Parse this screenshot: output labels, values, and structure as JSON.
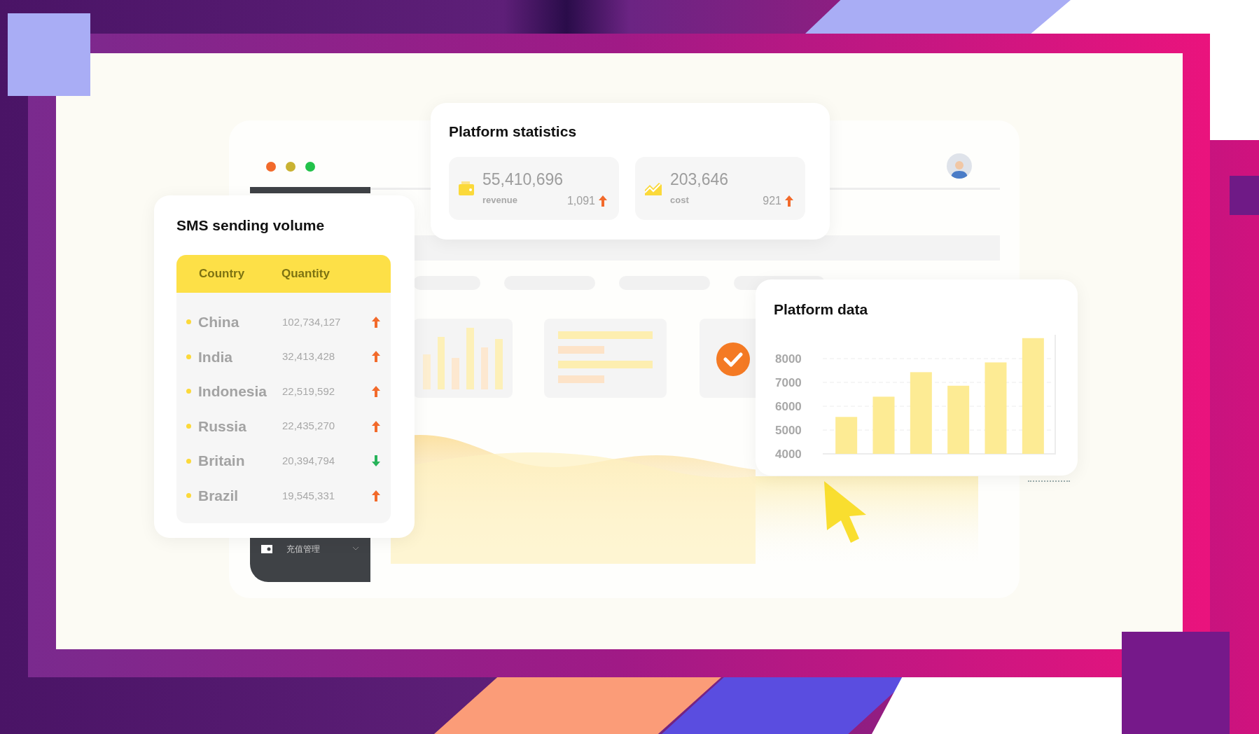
{
  "stats_card": {
    "title": "Platform statistics",
    "metrics": [
      {
        "kind": "wallet",
        "value": "55,410,696",
        "label": "revenue",
        "change": "1,091",
        "rising": true
      },
      {
        "kind": "trend",
        "value": "203,646",
        "label": "cost",
        "change": "921",
        "rising": true
      }
    ]
  },
  "sms_card": {
    "title": "SMS sending volume",
    "columns": [
      "Country",
      "Quantity"
    ],
    "rows": [
      {
        "country": "China",
        "quantity": "102,734,127",
        "rising": true
      },
      {
        "country": "India",
        "quantity": "32,413,428",
        "rising": true
      },
      {
        "country": "Indonesia",
        "quantity": "22,519,592",
        "rising": true
      },
      {
        "country": "Russia",
        "quantity": "22,435,270",
        "rising": true
      },
      {
        "country": "Britain",
        "quantity": "20,394,794",
        "rising": false
      },
      {
        "country": "Brazil",
        "quantity": "19,545,331",
        "rising": true
      }
    ]
  },
  "chart_card": {
    "title": "Platform data",
    "chart_data": {
      "type": "bar",
      "grid": true,
      "ylim": [
        4000,
        9000
      ],
      "yticks": [
        4000,
        5000,
        6000,
        7000,
        8000
      ],
      "series": [
        {
          "color": "#fdeb94",
          "values": [
            5550,
            6400,
            7430,
            6860,
            7840,
            8860
          ]
        }
      ]
    }
  },
  "sidebar": {
    "items": [
      {
        "label": "充值管理"
      }
    ]
  }
}
